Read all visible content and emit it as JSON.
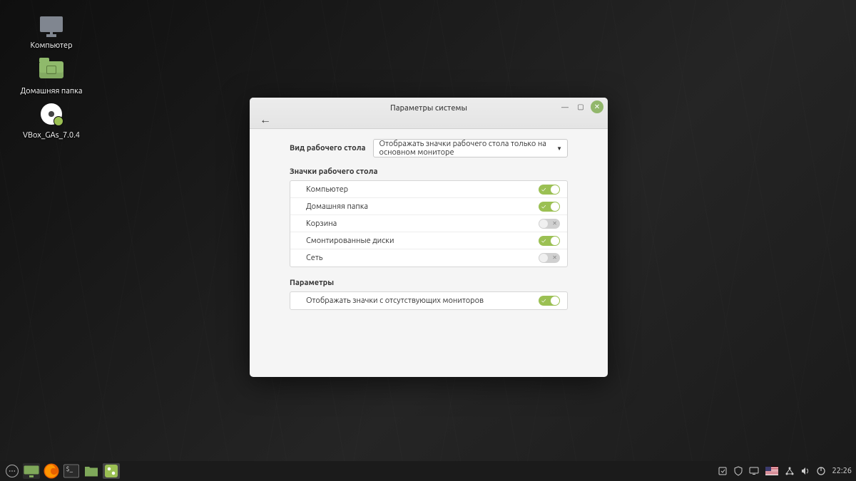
{
  "desktop_icons": {
    "computer": "Компьютер",
    "home": "Домашняя папка",
    "vbox": "VBox_GAs_7.0.4"
  },
  "window": {
    "title": "Параметры системы",
    "view_label": "Вид рабочего стола",
    "view_value": "Отображать значки рабочего стола только на основном мониторе",
    "section_icons": "Значки рабочего стола",
    "rows": {
      "computer": "Компьютер",
      "home": "Домашняя папка",
      "trash": "Корзина",
      "mounted": "Смонтированные диски",
      "network": "Сеть"
    },
    "section_params": "Параметры",
    "param_missing_monitors": "Отображать значки с отсутствующих мониторов"
  },
  "taskbar": {
    "clock": "22:26"
  },
  "colors": {
    "accent": "#9bc053"
  }
}
